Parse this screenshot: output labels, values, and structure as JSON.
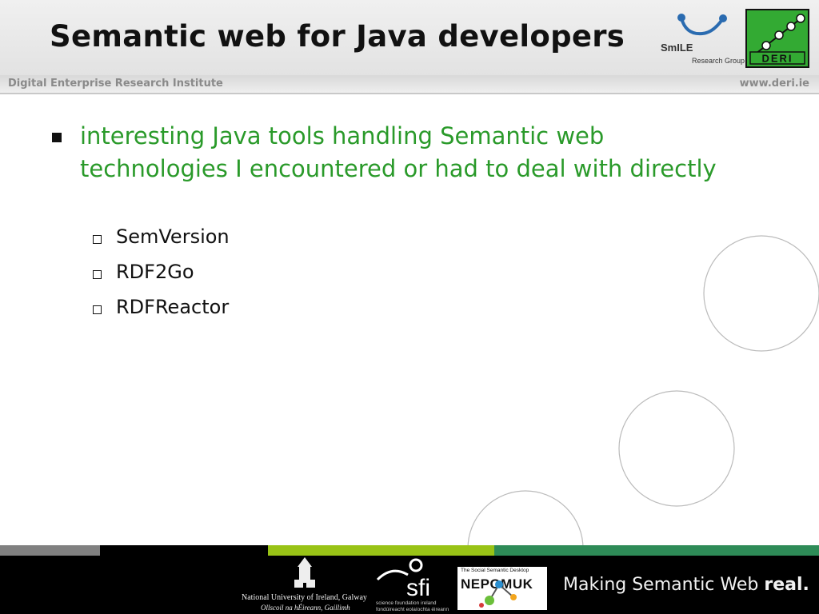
{
  "header": {
    "title": "Semantic web for Java developers",
    "institute": "Digital Enterprise Research Institute",
    "website": "www.deri.ie"
  },
  "logos": {
    "smile": {
      "name": "SmILE",
      "sub": "Research Group"
    },
    "deri": {
      "name": "DERI"
    },
    "nuig": {
      "line1": "National University of Ireland, Galway",
      "line2": "Ollscoil na hÉireann, Gaillimh"
    },
    "sfi": {
      "name": "sfi",
      "line1": "science foundation ireland",
      "line2": "fondúireacht eolaíochta éireann"
    },
    "nepomuk": {
      "sub": "The Social Semantic Desktop",
      "name": "NEPOMUK"
    }
  },
  "content": {
    "bullet_main": "interesting Java tools handling Semantic web technologies I encountered or had to deal with directly",
    "sub_items": [
      "SemVersion",
      "RDF2Go",
      "RDFReactor"
    ]
  },
  "footer": {
    "tagline_regular": "Making Semantic Web ",
    "tagline_bold": "real."
  },
  "colors": {
    "accent_green": "#2a9a2a",
    "stripe_gray": "#808080",
    "stripe_lime": "#99c316",
    "stripe_green": "#2e8b57"
  }
}
